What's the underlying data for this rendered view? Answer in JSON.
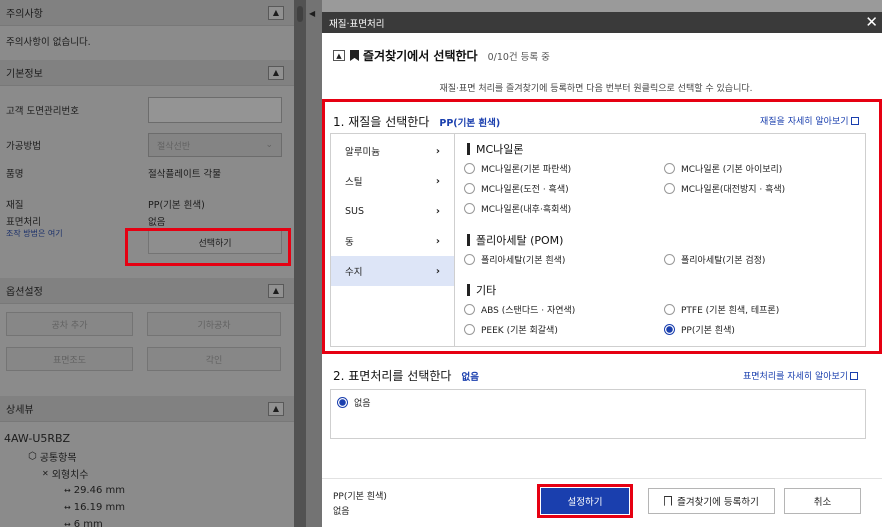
{
  "left": {
    "notice": {
      "title": "주의사항",
      "text": "주의사항이 없습니다."
    },
    "basic": {
      "title": "기본정보",
      "customer_no_label": "고객 도면관리번호",
      "method_label": "가공방법",
      "method_value": "절삭선반",
      "name_label": "품명",
      "name_value": "절삭플레이트 각물",
      "material_label": "재질",
      "material_value": "PP(기본 흰색)",
      "surface_label": "표면처리",
      "surface_value": "없음",
      "how_to_link": "조작 방법은 여기",
      "select_button": "선택하기"
    },
    "options": {
      "title": "옵션설정",
      "btn1": "공차 추가",
      "btn2": "기하공차",
      "btn3": "표면조도",
      "btn4": "각인"
    },
    "detail": {
      "title": "상세뷰",
      "part_no": "4AW-U5RBZ",
      "common": "공통항목",
      "dims": "외형치수",
      "dim_values": [
        "29.46 mm",
        "16.19 mm",
        "6 mm"
      ]
    }
  },
  "modal": {
    "title": "재질·표면처리",
    "fav_title": "즐겨찾기에서 선택한다",
    "fav_count": "0/10건 등록 중",
    "fav_desc": "재질·표면 처리를 즐겨찾기에 등록하면 다음 번부터 원클릭으로 선택할 수 있습니다.",
    "section1": {
      "title": "1. 재질을 선택한다",
      "selected": "PP(기본 흰색)",
      "link": "재질을 자세히 알아보기",
      "categories": [
        "알루미늄",
        "스틸",
        "SUS",
        "동",
        "수지"
      ],
      "groups": [
        {
          "title": "MC나일론",
          "options": [
            "MC나일론(기본 파란색)",
            "MC나일론 (기본 아이보리)",
            "MC나일론(도전 · 흑색)",
            "MC나일론(대전방지 · 흑색)",
            "MC나일론(내후·흑회색)"
          ]
        },
        {
          "title": "폴리아세탈 (POM)",
          "options": [
            "폴리아세탈(기본 흰색)",
            "폴리아세탈(기본 검정)"
          ]
        },
        {
          "title": "기타",
          "options": [
            "ABS (스탠다드 · 자연색)",
            "PTFE (기본 흰색, 테프론)",
            "PEEK (기본 회갈색)",
            "PP(기본 흰색)"
          ]
        }
      ]
    },
    "section2": {
      "title": "2. 표면처리를 선택한다",
      "selected": "없음",
      "link": "표면처리를 자세히 알아보기",
      "option": "없음"
    },
    "footer": {
      "material": "PP(기본 흰색)",
      "surface": "없음",
      "set_button": "설정하기",
      "fav_button": "즐겨찾기에 등록하기",
      "cancel_button": "취소"
    }
  }
}
